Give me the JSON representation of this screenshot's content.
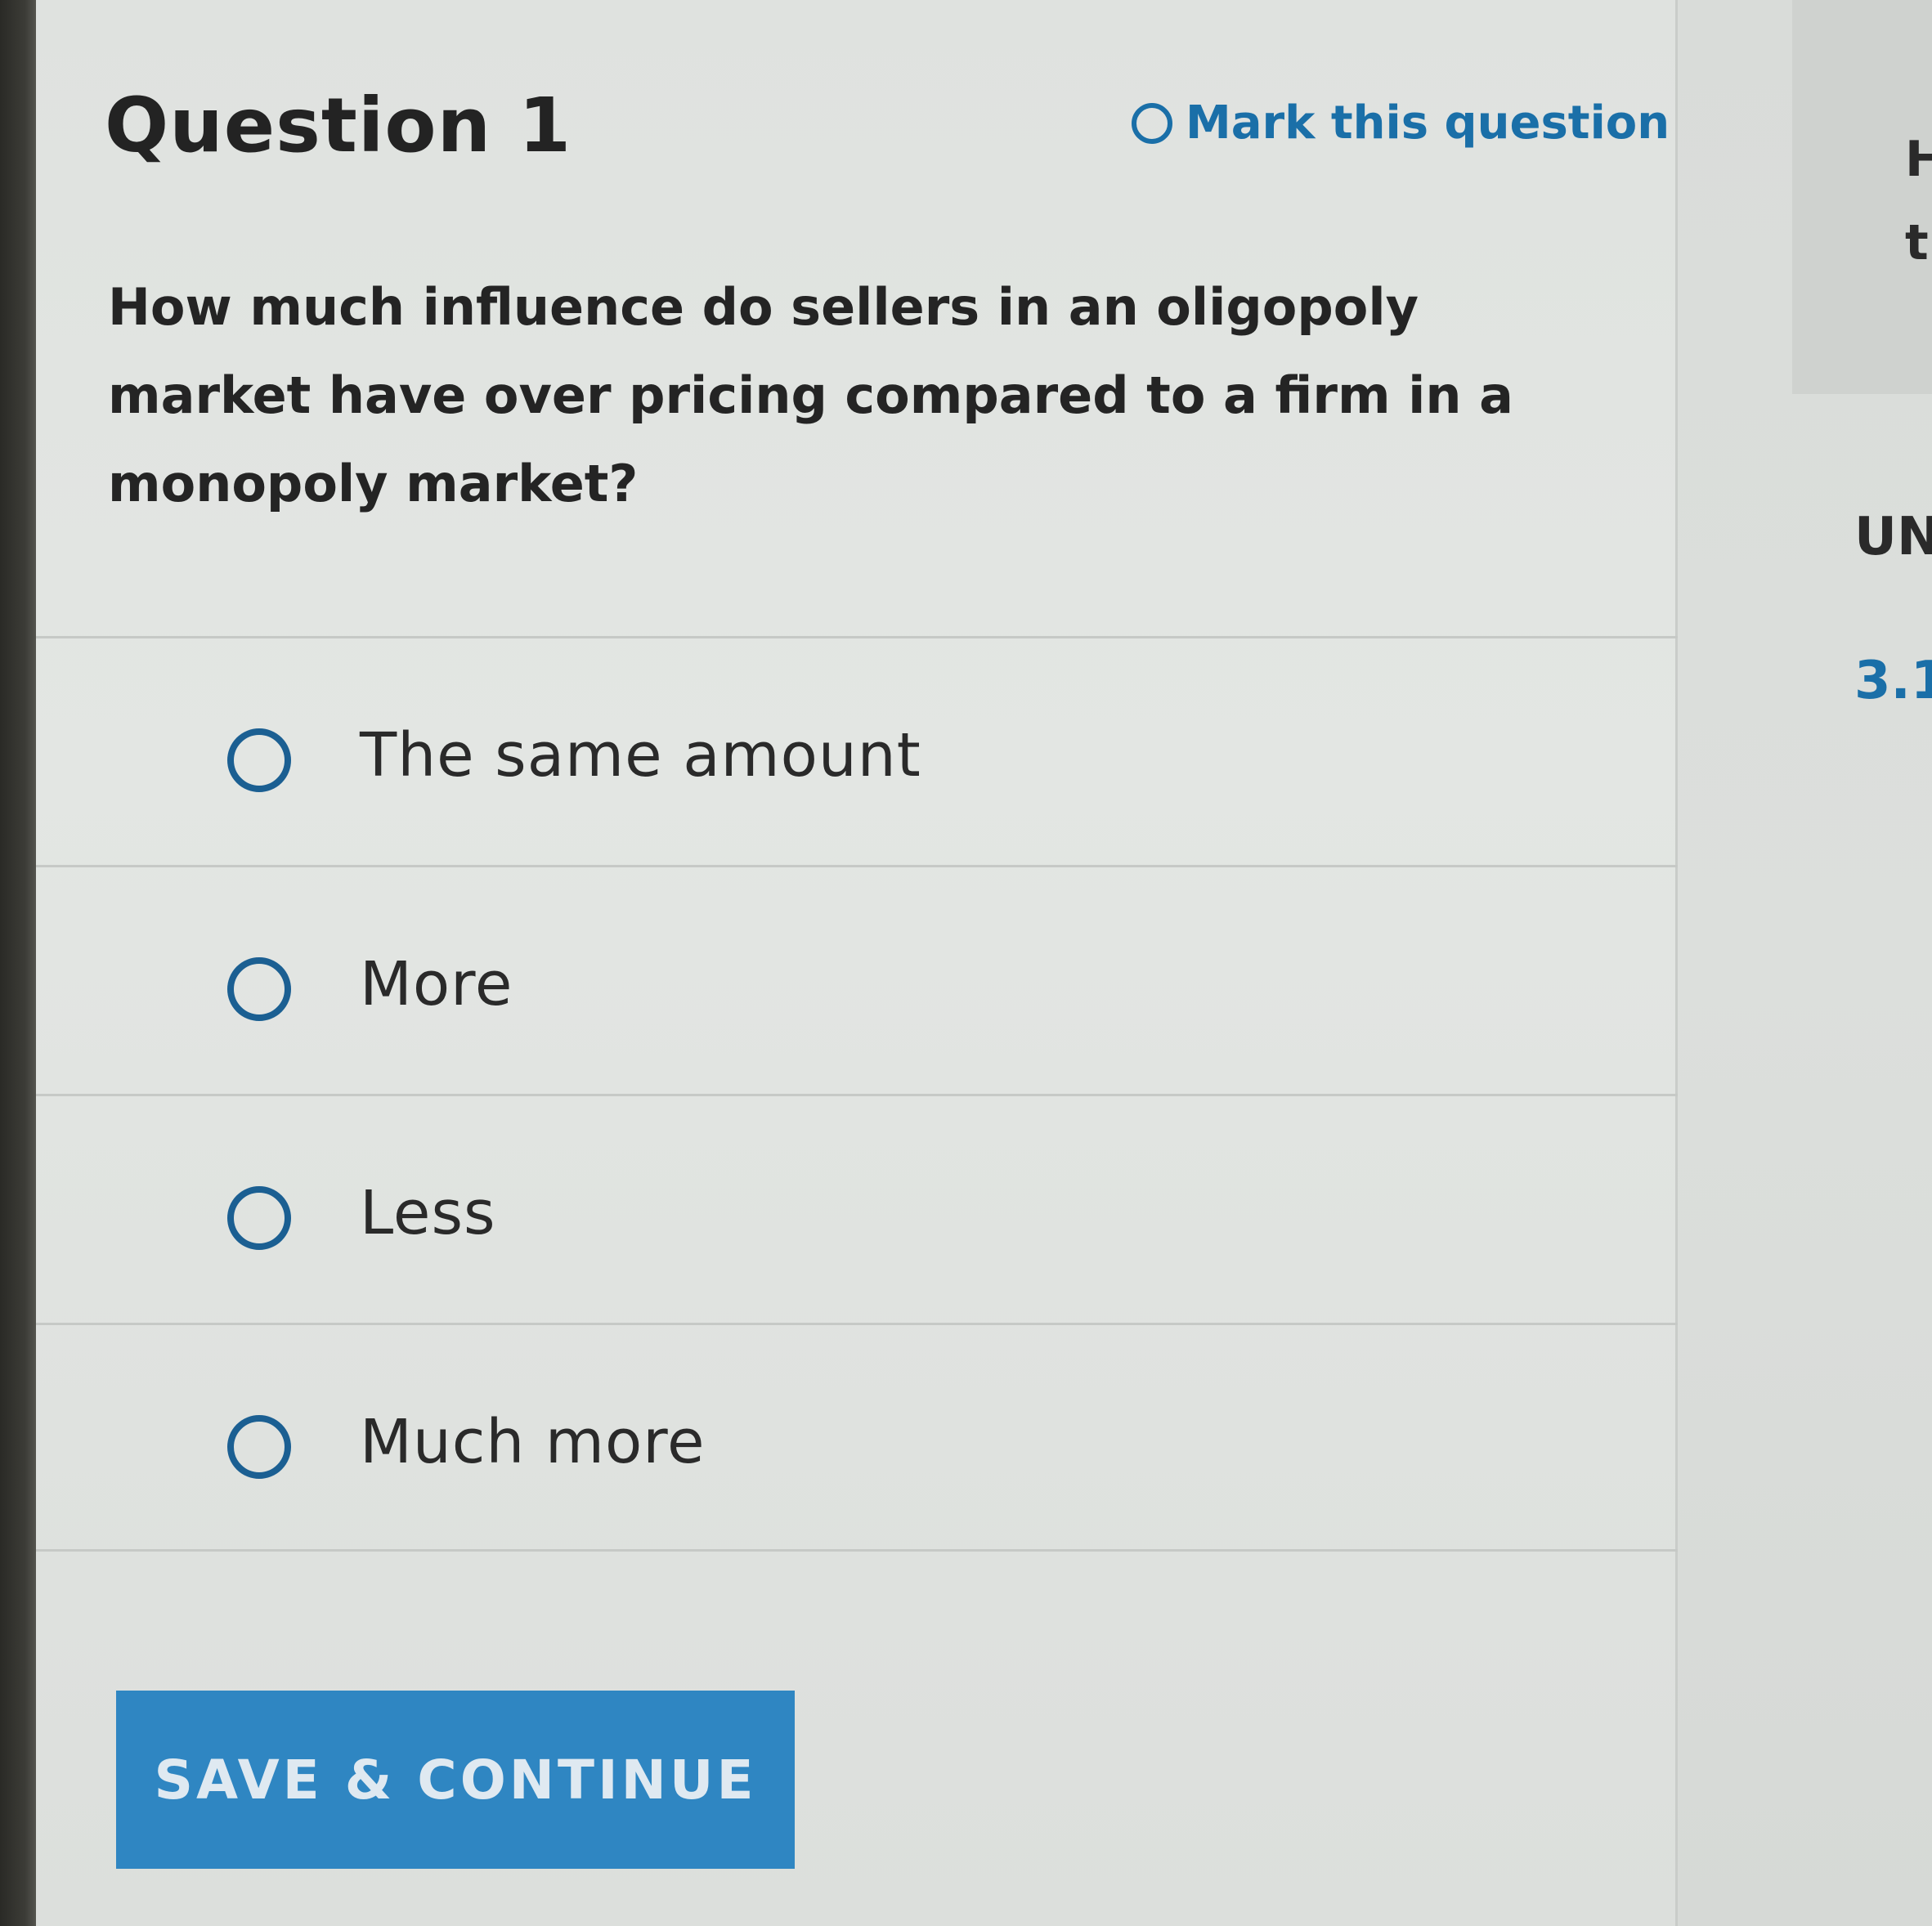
{
  "question": {
    "title": "Question 1",
    "mark_label": "Mark this question",
    "text": "How much influence do sellers in an oligopoly market have over pricing compared to a firm in a monopoly market?"
  },
  "options": [
    {
      "label": "The same amount",
      "selected": false
    },
    {
      "label": "More",
      "selected": false
    },
    {
      "label": "Less",
      "selected": false
    },
    {
      "label": "Much more",
      "selected": false
    }
  ],
  "actions": {
    "save_label": "SAVE & CONTINUE"
  },
  "side_panel": {
    "fragment_1": "H",
    "fragment_2": "tl",
    "heading_fragment": "UN",
    "number_fragment": "3.1"
  },
  "colors": {
    "accent": "#1a6fa8",
    "button": "#2f86c2",
    "radio": "#1b5f92"
  },
  "icons": {
    "mark": "radio-ring-icon",
    "option_radio": "radio-ring-icon"
  }
}
